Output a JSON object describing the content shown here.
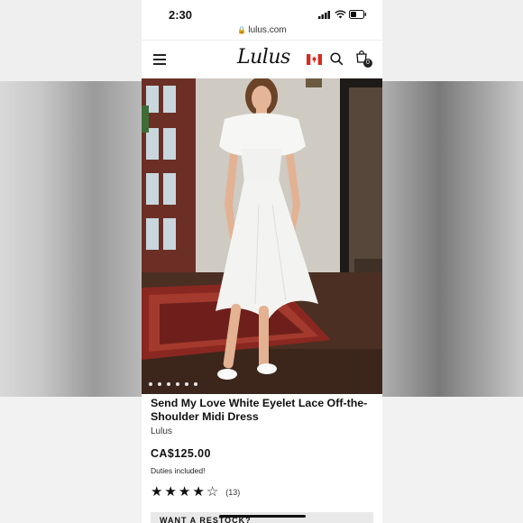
{
  "status_bar": {
    "time": "2:30"
  },
  "browser": {
    "url": "lulus.com"
  },
  "header": {
    "logo": "Lulus",
    "cart_count": "0",
    "flag": "canada-flag-icon"
  },
  "gallery": {
    "dot_count": 6
  },
  "product": {
    "title": "Send My Love White Eyelet Lace Off-the-Shoulder Midi Dress",
    "brand": "Lulus",
    "price": "CA$125.00",
    "duties_note": "Duties included!",
    "rating": 4,
    "rating_max": 5,
    "review_count": "(13)"
  },
  "cta": {
    "label": "WANT A RESTOCK?"
  },
  "colors": {
    "accent": "#111111",
    "flag_red": "#d52b1e"
  }
}
